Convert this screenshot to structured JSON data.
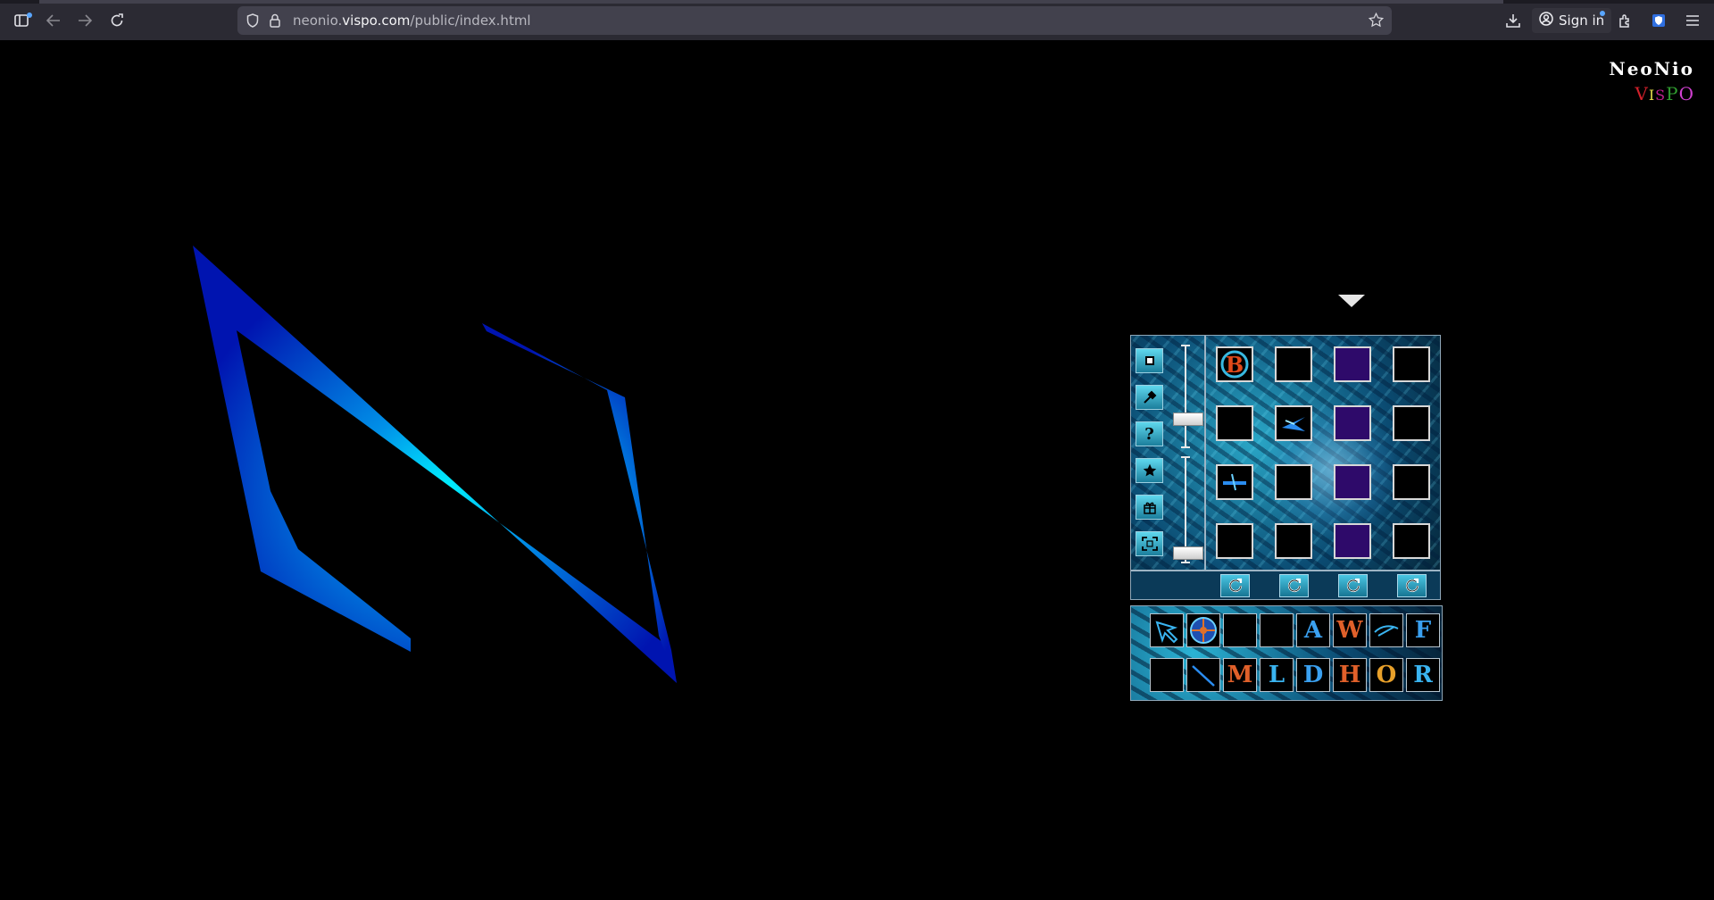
{
  "browser": {
    "url_prefix": "neonio.",
    "url_domain": "vispo.com",
    "url_path": "/public/index.html",
    "signin_label": "Sign in",
    "icons": [
      "sidebar-icon",
      "back-icon",
      "forward-icon",
      "reload-icon",
      "shield-icon",
      "lock-icon",
      "bookmark-star-icon",
      "download-icon",
      "account-icon",
      "extensions-icon",
      "container-icon",
      "menu-icon"
    ]
  },
  "brand": {
    "title": "NeoNio",
    "subtitle_letters": [
      {
        "ch": "V",
        "color": "#d0202a"
      },
      {
        "ch": "I",
        "color": "#e8e04a"
      },
      {
        "ch": "S",
        "color": "#c02090"
      },
      {
        "ch": "P",
        "color": "#2f9a2f"
      },
      {
        "ch": "O",
        "color": "#d040d0"
      }
    ]
  },
  "logo": {
    "name": "neonio-N-logo",
    "colors": [
      "#0016a8",
      "#00f0ff"
    ]
  },
  "widget": {
    "tools": [
      "stop-icon",
      "hammer-icon",
      "help-icon",
      "star-icon",
      "gift-icon",
      "fullscreen-icon"
    ],
    "slider_positions": [
      0.62,
      0.92
    ],
    "grid": [
      [
        "B-ornate",
        "empty",
        "violet",
        "empty"
      ],
      [
        "empty",
        "blue-spark",
        "violet",
        "empty"
      ],
      [
        "blue-dash",
        "empty",
        "violet",
        "empty"
      ],
      [
        "empty",
        "empty",
        "violet",
        "empty"
      ]
    ],
    "refresh_buttons": [
      "refresh-col-1",
      "refresh-col-2",
      "refresh-col-3",
      "refresh-col-4"
    ],
    "palette_row1": [
      "arrow",
      "compass",
      "empty",
      "empty",
      "A",
      "W",
      "swoosh",
      "F"
    ],
    "palette_row2": [
      "empty",
      "line",
      "M",
      "L",
      "D",
      "H",
      "O",
      "R"
    ]
  }
}
